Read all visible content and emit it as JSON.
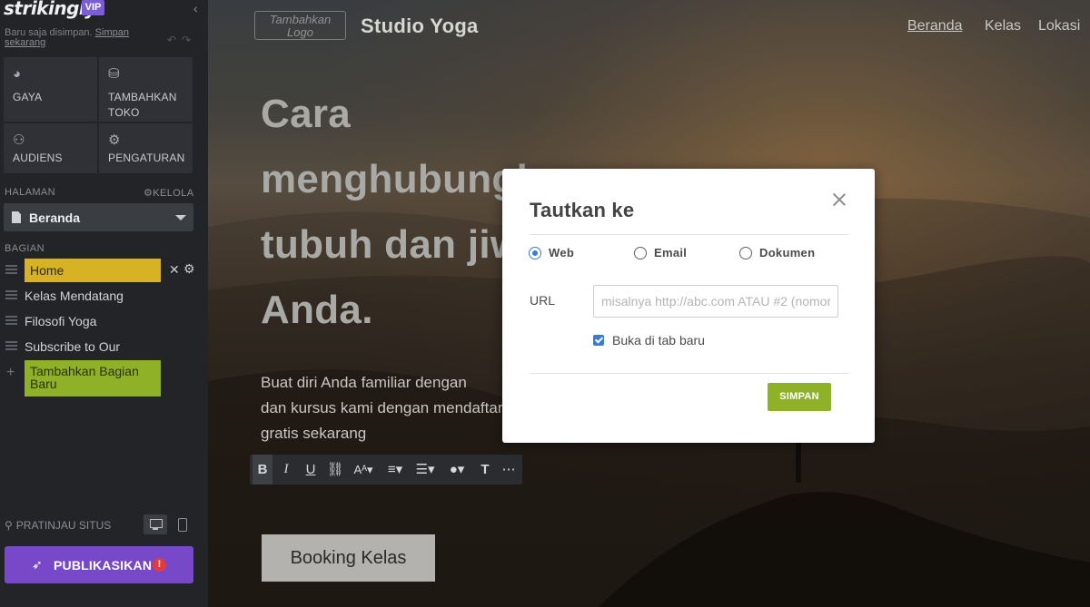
{
  "sidebar": {
    "brand": "strikingly",
    "badge": "VIP",
    "save_status": "Baru saja disimpan.",
    "save_link": "Simpan sekarang",
    "tiles": [
      {
        "label": "GAYA",
        "icon": "palette-icon"
      },
      {
        "label": "TAMBAHKAN TOKO",
        "icon": "store-icon"
      },
      {
        "label": "AUDIENS",
        "icon": "people-icon"
      },
      {
        "label": "PENGATURAN",
        "icon": "gear-icon"
      }
    ],
    "pages_label": "HALAMAN",
    "manage_label": "KELOLA",
    "current_page": "Beranda",
    "sections_label": "BAGIAN",
    "sections": [
      "Home",
      "Kelas Mendatang",
      "Filosofi Yoga",
      "Subscribe to Our"
    ],
    "add_section": "Tambahkan Bagian Baru",
    "preview_label": "PRATINJAU SITUS",
    "publish_label": "PUBLIKASIKAN",
    "publish_alert": "!"
  },
  "site": {
    "logo_placeholder": "Tambahkan Logo",
    "title": "Studio Yoga",
    "nav": [
      "Beranda",
      "Kelas",
      "Lokasi"
    ],
    "hero_title_lines": [
      "Cara",
      "menghubungkan",
      "tubuh dan jiwa",
      "Anda."
    ],
    "hero_body_lines": [
      "Buat diri Anda familiar dengan",
      "dan kursus kami dengan mendaftar",
      "gratis sekarang"
    ],
    "cta": "Booking Kelas",
    "toolbar_icons": [
      "bold-icon",
      "italic-icon",
      "underline-icon",
      "link-icon",
      "font-size-icon",
      "align-icon",
      "list-icon",
      "color-icon",
      "text-style-icon",
      "more-icon"
    ]
  },
  "modal": {
    "title": "Tautkan ke",
    "options": [
      "Web",
      "Email",
      "Dokumen"
    ],
    "selected_option": "Web",
    "url_label": "URL",
    "url_value": "",
    "url_placeholder": "misalnya http://abc.com ATAU #2 (nomor bagian)",
    "new_tab_label": "Buka di tab baru",
    "new_tab_checked": true,
    "save_label": "SIMPAN"
  }
}
